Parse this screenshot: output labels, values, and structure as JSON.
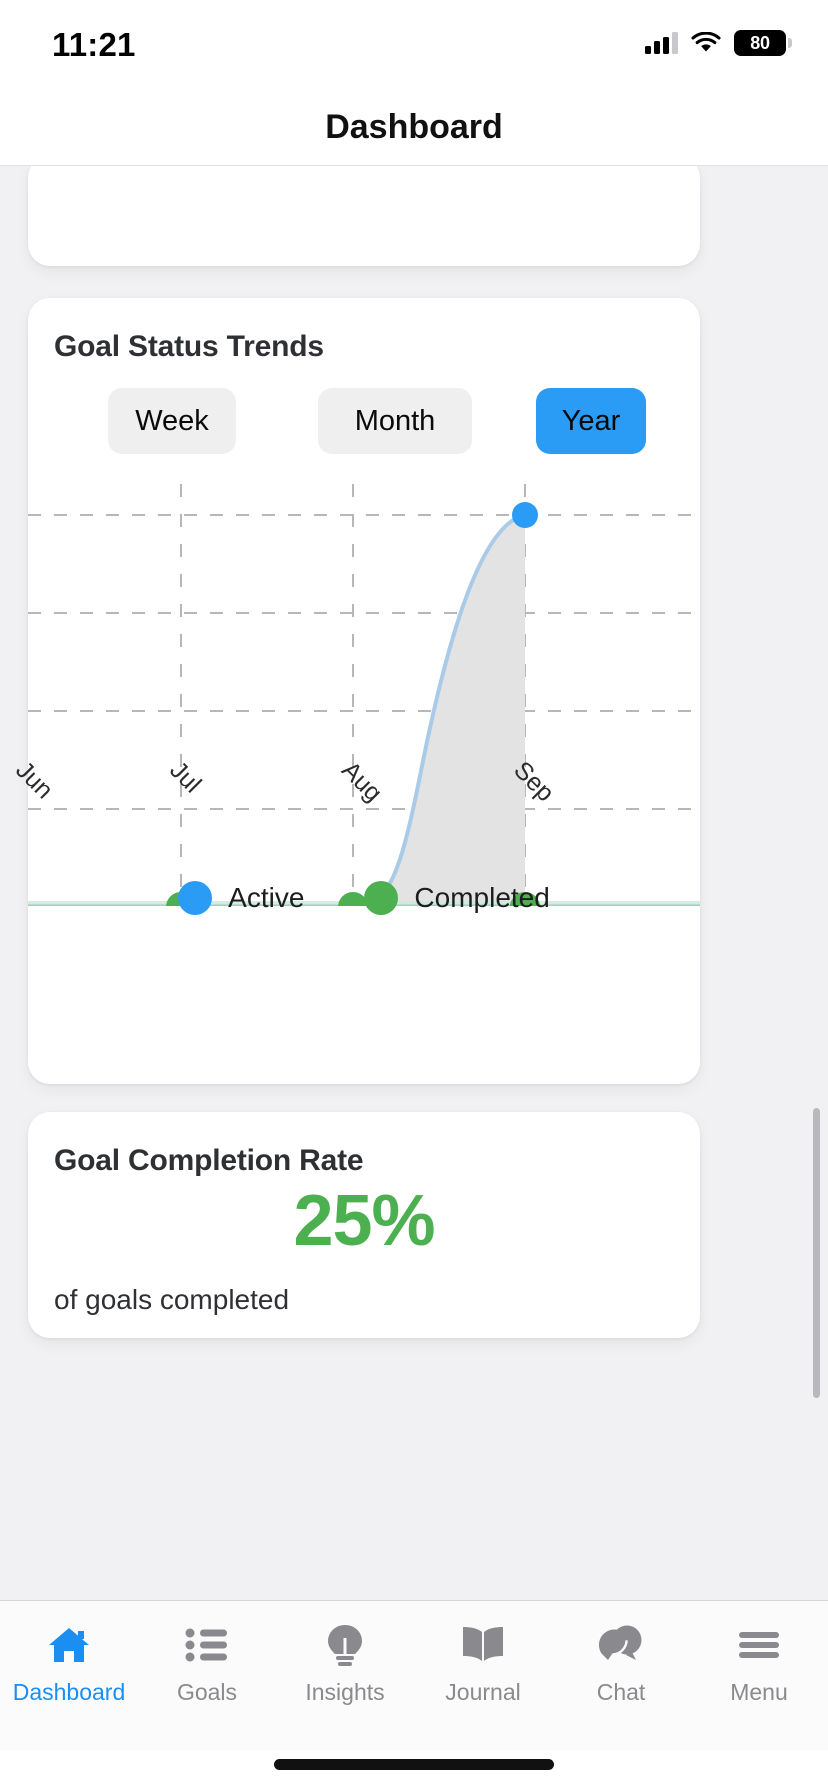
{
  "status_bar": {
    "time": "11:21",
    "battery_level": "80",
    "cellular_icon": "cellular-bars-icon",
    "wifi_icon": "wifi-icon",
    "battery_icon": "battery-icon"
  },
  "header": {
    "title": "Dashboard"
  },
  "trends_card": {
    "title": "Goal Status Trends",
    "range_options": [
      {
        "label": "Week",
        "selected": false
      },
      {
        "label": "Month",
        "selected": false
      },
      {
        "label": "Year",
        "selected": true
      }
    ]
  },
  "rate_card": {
    "title": "Goal Completion Rate",
    "value": "25%",
    "subtitle": "of goals completed"
  },
  "tab_bar": {
    "items": [
      {
        "label": "Dashboard",
        "icon": "home-icon",
        "active": true
      },
      {
        "label": "Goals",
        "icon": "list-icon",
        "active": false
      },
      {
        "label": "Insights",
        "icon": "lightbulb-icon",
        "active": false
      },
      {
        "label": "Journal",
        "icon": "book-icon",
        "active": false
      },
      {
        "label": "Chat",
        "icon": "chat-icon",
        "active": false
      },
      {
        "label": "Menu",
        "icon": "hamburger-icon",
        "active": false
      }
    ]
  },
  "colors": {
    "accent_blue": "#2a9cf5",
    "tab_active_blue": "#1b8ef2",
    "completed_green": "#4caf50",
    "rate_green": "#4caf50",
    "grid_gray": "#b7b7b7",
    "area_fill": "#e3e3e3",
    "page_background": "#f1f1f3",
    "card_background": "#ffffff"
  },
  "chart_data": {
    "type": "area",
    "title": "Goal Status Trends",
    "xlabel": "",
    "ylabel": "",
    "x": [
      "Jun",
      "Jul",
      "Aug",
      "Sep"
    ],
    "tick_labels_visible": [
      "Jul",
      "Aug",
      "Sep"
    ],
    "series": [
      {
        "name": "Active",
        "color": "#2a9cf5",
        "values": [
          0,
          0,
          0,
          4
        ]
      },
      {
        "name": "Completed",
        "color": "#4caf50",
        "values": [
          0,
          0,
          0,
          0
        ]
      }
    ],
    "ylim": [
      0,
      4
    ],
    "grid": true,
    "grid_style": "dashed",
    "legend": [
      "Active",
      "Completed"
    ],
    "legend_position": "bottom",
    "x_tick_label_rotation": 45,
    "markers": [
      {
        "series": "Active",
        "x": "Sep",
        "value": 4
      },
      {
        "series": "Completed",
        "x": "Jul",
        "value": 0
      },
      {
        "series": "Completed",
        "x": "Aug",
        "value": 0
      },
      {
        "series": "Completed",
        "x": "Sep",
        "value": 0
      }
    ]
  }
}
